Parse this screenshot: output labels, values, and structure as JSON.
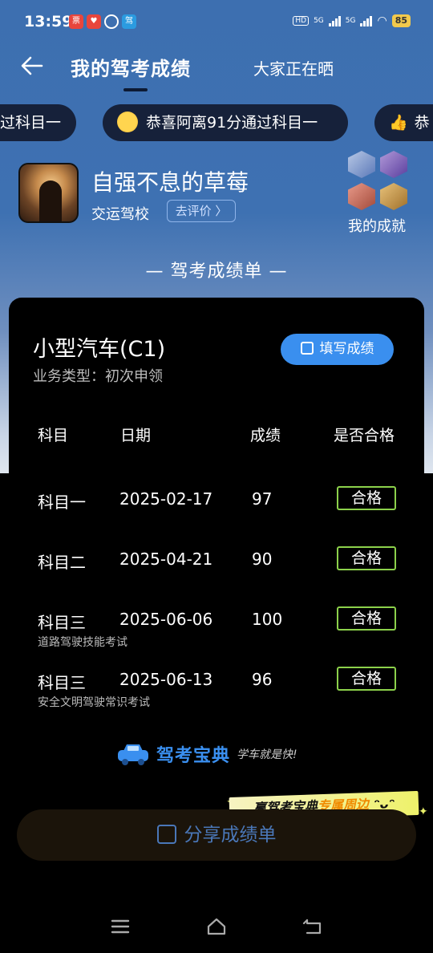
{
  "status_bar": {
    "time": "13:59",
    "network_1": "5G",
    "network_2": "5G",
    "hd_label": "HD",
    "battery": "85"
  },
  "header": {
    "title": "我的驾考成绩",
    "second_tab": "大家正在晒"
  },
  "ticker": {
    "items": [
      "过科目一",
      "恭喜阿离91分通过科目一",
      "恭"
    ]
  },
  "profile": {
    "nickname": "自强不息的草莓",
    "school": "交运驾校",
    "rate_button": "去评价 〉",
    "achievements_label": "我的成就"
  },
  "section_title": "— 驾考成绩单 —",
  "card": {
    "vehicle": "小型汽车(C1)",
    "business_type": "业务类型：初次申领",
    "fill_button": "填写成绩",
    "columns": [
      "科目",
      "日期",
      "成绩",
      "是否合格"
    ],
    "rows": [
      {
        "subject": "科目一",
        "date": "2025-02-17",
        "score": "97",
        "status": "合格",
        "note": ""
      },
      {
        "subject": "科目二",
        "date": "2025-04-21",
        "score": "90",
        "status": "合格",
        "note": ""
      },
      {
        "subject": "科目三",
        "date": "2025-06-06",
        "score": "100",
        "status": "合格",
        "note": "道路驾驶技能考试"
      },
      {
        "subject": "科目三",
        "date": "2025-06-13",
        "score": "96",
        "status": "合格",
        "note": "安全文明驾驶常识考试"
      }
    ],
    "brand_name": "驾考宝典",
    "brand_slogan": "学车就是快!"
  },
  "promo": {
    "part1": "赢驾考宝典",
    "part2": "专属周边"
  },
  "share_button": "分享成绩单",
  "colors": {
    "header_blue": "#3d6fb0",
    "accent_blue": "#3a8fef",
    "pass_green": "#8cd14b",
    "card_bg": "#000000"
  },
  "icons": [
    "back-arrow-icon",
    "edit-icon",
    "share-icon",
    "menu-icon",
    "home-icon",
    "return-icon",
    "car-icon"
  ]
}
